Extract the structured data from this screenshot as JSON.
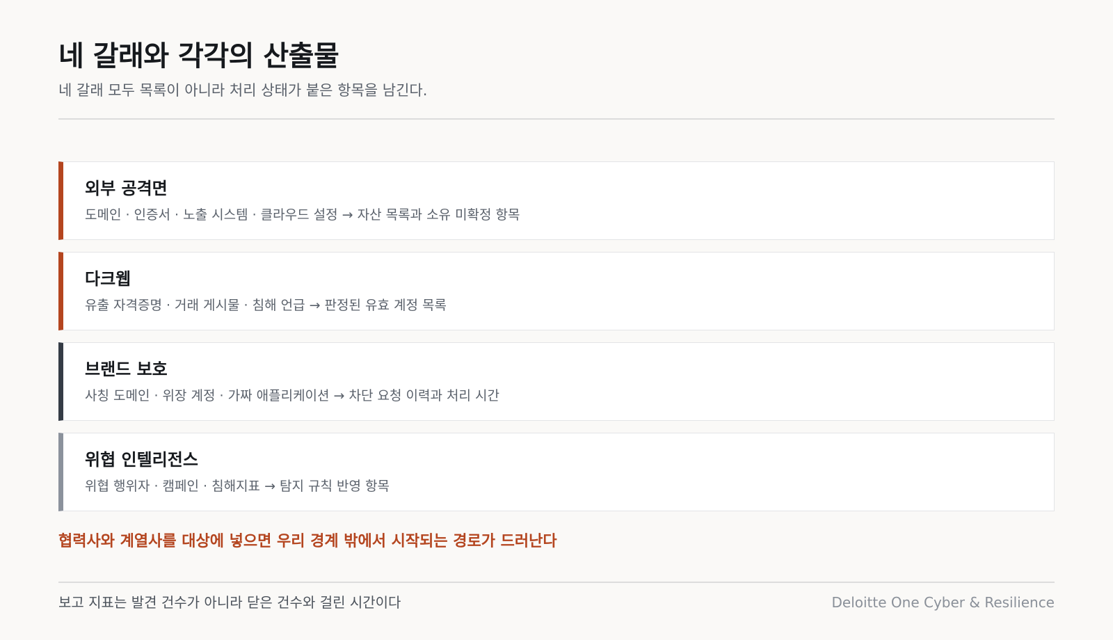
{
  "header": {
    "title": "네 갈래와 각각의 산출물",
    "subtitle": "네 갈래 모두 목록이 아니라 처리 상태가 붙은 항목을 남긴다."
  },
  "cards": [
    {
      "title": "외부 공격면",
      "description": "도메인 · 인증서 · 노출 시스템 · 클라우드 설정 → 자산 목록과 소유 미확정 항목",
      "accent": "#b4451f"
    },
    {
      "title": "다크웹",
      "description": "유출 자격증명 · 거래 게시물 · 침해 언급 → 판정된 유효 계정 목록",
      "accent": "#b4451f"
    },
    {
      "title": "브랜드 보호",
      "description": "사칭 도메인 · 위장 계정 · 가짜 애플리케이션 → 차단 요청 이력과 처리 시간",
      "accent": "#353c46"
    },
    {
      "title": "위협 인텔리전스",
      "description": "위협 행위자 · 캠페인 · 침해지표 → 탐지 규칙 반영 항목",
      "accent": "#8b929c"
    }
  ],
  "callout": "협력사와 계열사를 대상에 넣으면 우리 경계 밖에서 시작되는 경로가 드러난다",
  "footer": {
    "note": "보고 지표는 발견 건수가 아니라 닫은 건수와 걸린 시간이다",
    "brand": "Deloitte One Cyber & Resilience"
  }
}
